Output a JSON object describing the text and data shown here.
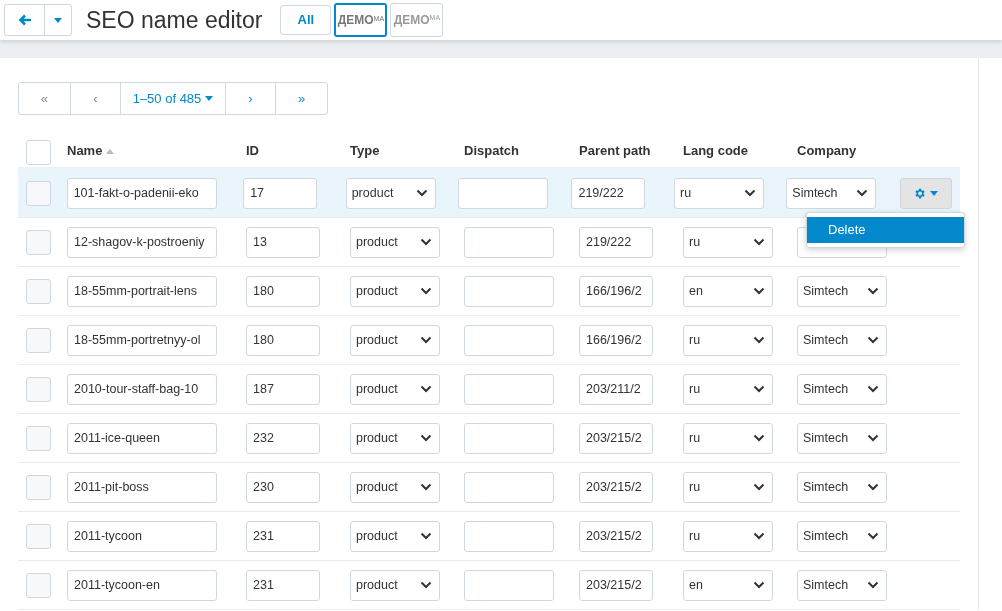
{
  "header": {
    "title": "SEO name editor",
    "stores": [
      {
        "kind": "text",
        "label": "All",
        "selected": false
      },
      {
        "kind": "logo",
        "label": "ДЕМО",
        "suffix": "МА",
        "selected": true
      },
      {
        "kind": "logo",
        "label": "ДЕМО",
        "suffix": "МА",
        "selected": false
      }
    ]
  },
  "pagination": {
    "first": "«",
    "prev": "‹",
    "range": "1–50 of 485",
    "next": "›",
    "last": "»"
  },
  "table": {
    "select_all_checked": false,
    "columns": [
      {
        "label": "Name",
        "sorted": true
      },
      {
        "label": "ID",
        "sorted": false
      },
      {
        "label": "Type",
        "sorted": false
      },
      {
        "label": "Dispatch",
        "sorted": false
      },
      {
        "label": "Parent path",
        "sorted": false
      },
      {
        "label": "Lang code",
        "sorted": false
      },
      {
        "label": "Company",
        "sorted": false
      }
    ],
    "rows": [
      {
        "name": "101-fakt-o-padenii-eko",
        "id": "17",
        "type": "product",
        "dispatch": "",
        "parent_path": "219/222",
        "lang": "ru",
        "company": "Simtech",
        "hovered": true,
        "actions": true
      },
      {
        "name": "12-shagov-k-postroeniy",
        "id": "13",
        "type": "product",
        "dispatch": "",
        "parent_path": "219/222",
        "lang": "ru",
        "hovered": false,
        "actions": false
      },
      {
        "name": "18-55mm-portrait-lens",
        "id": "180",
        "type": "product",
        "dispatch": "",
        "parent_path": "166/196/2",
        "lang": "en",
        "company": "Simtech",
        "hovered": false,
        "actions": false
      },
      {
        "name": "18-55mm-portretnyy-ol",
        "id": "180",
        "type": "product",
        "dispatch": "",
        "parent_path": "166/196/2",
        "lang": "ru",
        "company": "Simtech",
        "hovered": false,
        "actions": false
      },
      {
        "name": "2010-tour-staff-bag-10",
        "id": "187",
        "type": "product",
        "dispatch": "",
        "parent_path": "203/211/2",
        "lang": "ru",
        "company": "Simtech",
        "hovered": false,
        "actions": false
      },
      {
        "name": "2011-ice-queen",
        "id": "232",
        "type": "product",
        "dispatch": "",
        "parent_path": "203/215/2",
        "lang": "ru",
        "company": "Simtech",
        "hovered": false,
        "actions": false
      },
      {
        "name": "2011-pit-boss",
        "id": "230",
        "type": "product",
        "dispatch": "",
        "parent_path": "203/215/2",
        "lang": "ru",
        "company": "Simtech",
        "hovered": false,
        "actions": false
      },
      {
        "name": "2011-tycoon",
        "id": "231",
        "type": "product",
        "dispatch": "",
        "parent_path": "203/215/2",
        "lang": "ru",
        "company": "Simtech",
        "hovered": false,
        "actions": false
      },
      {
        "name": "2011-tycoon-en",
        "id": "231",
        "type": "product",
        "dispatch": "",
        "parent_path": "203/215/2",
        "lang": "en",
        "company": "Simtech",
        "hovered": false,
        "actions": false
      }
    ]
  },
  "action_menu": {
    "open": true,
    "items": [
      {
        "label": "Delete",
        "selected": true
      }
    ]
  }
}
